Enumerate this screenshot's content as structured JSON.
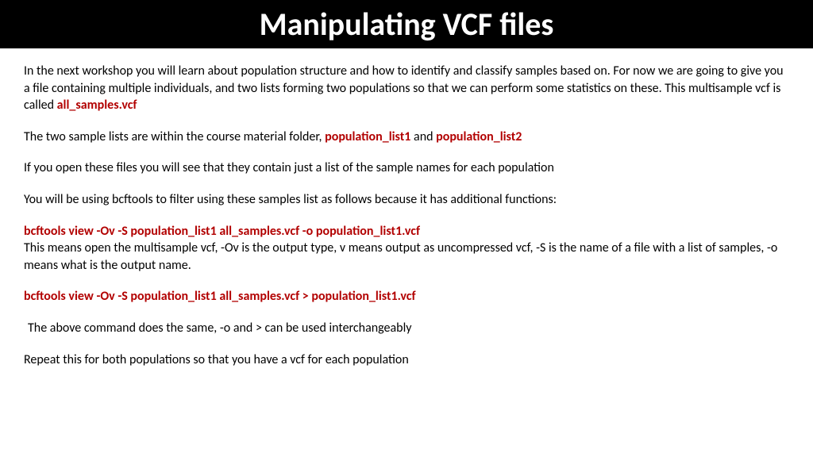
{
  "header": {
    "title": "Manipulating VCF files"
  },
  "content": {
    "p1a": "In the next workshop you will learn about population structure and how to identify and classify samples based on. For now we are going to give you a file containing multiple individuals, and two lists forming two populations so that we can perform some statistics on these. This multisample vcf is called ",
    "p1_file": "all_samples.vcf",
    "p2a": "The two sample lists are within the course material folder, ",
    "p2_file1": "population_list1",
    "p2_and": " and ",
    "p2_file2": "population_list2",
    "p3": "If you open these files you will see that they contain just a list of the sample names for each population",
    "p4": "You will be using bcftools to filter using these samples list as follows because it has additional functions:",
    "cmd1": "bcftools view -Ov -S population_list1 all_samples.vcf -o population_list1.vcf",
    "p5": "This means open the multisample vcf, -Ov is the output type, v means output as uncompressed vcf, -S is the name of a file with a list of samples, -o means what is the output name.",
    "cmd2": "bcftools view -Ov -S population_list1 all_samples.vcf > population_list1.vcf",
    "p6": " The above command does the same, -o and > can be used interchangeably",
    "p7": "Repeat this for both populations so that you have a vcf for each population"
  }
}
